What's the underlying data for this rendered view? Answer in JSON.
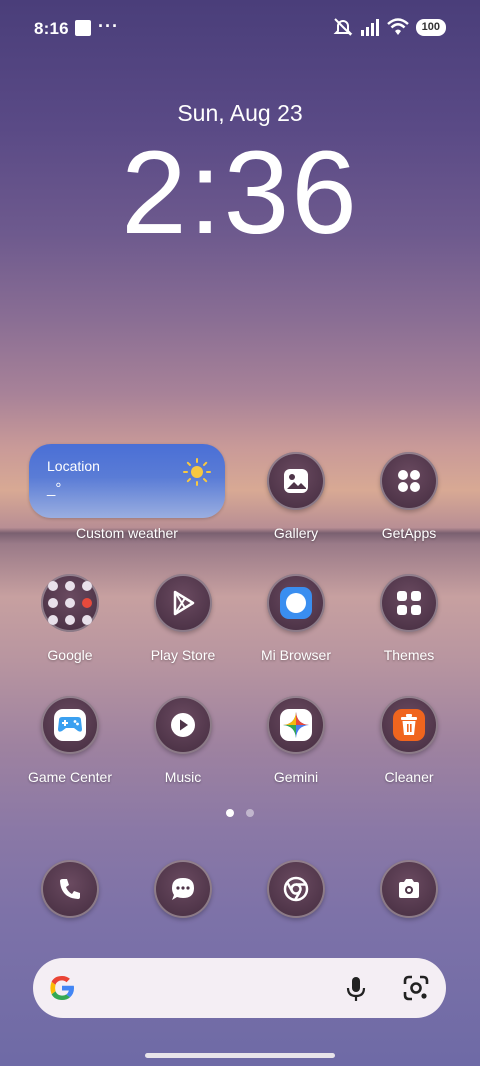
{
  "status_bar": {
    "time": "8:16",
    "more": "···",
    "battery": "100"
  },
  "lock": {
    "date": "Sun, Aug 23",
    "time": "2:36"
  },
  "weather": {
    "location": "Location",
    "temp": "_°",
    "label": "Custom weather"
  },
  "apps": {
    "gallery": "Gallery",
    "getapps": "GetApps",
    "google": "Google",
    "playstore": "Play Store",
    "mibrowser": "Mi Browser",
    "themes": "Themes",
    "gamecenter": "Game Center",
    "music": "Music",
    "gemini": "Gemini",
    "cleaner": "Cleaner"
  },
  "dock": [
    "phone-icon",
    "messages-icon",
    "chrome-icon",
    "camera-icon"
  ],
  "pages": {
    "count": 2,
    "current": 1
  },
  "colors": {
    "cleaner": "#f0651e",
    "browser": "#3a8ef0",
    "gamecenter": "#3ba0f0"
  }
}
